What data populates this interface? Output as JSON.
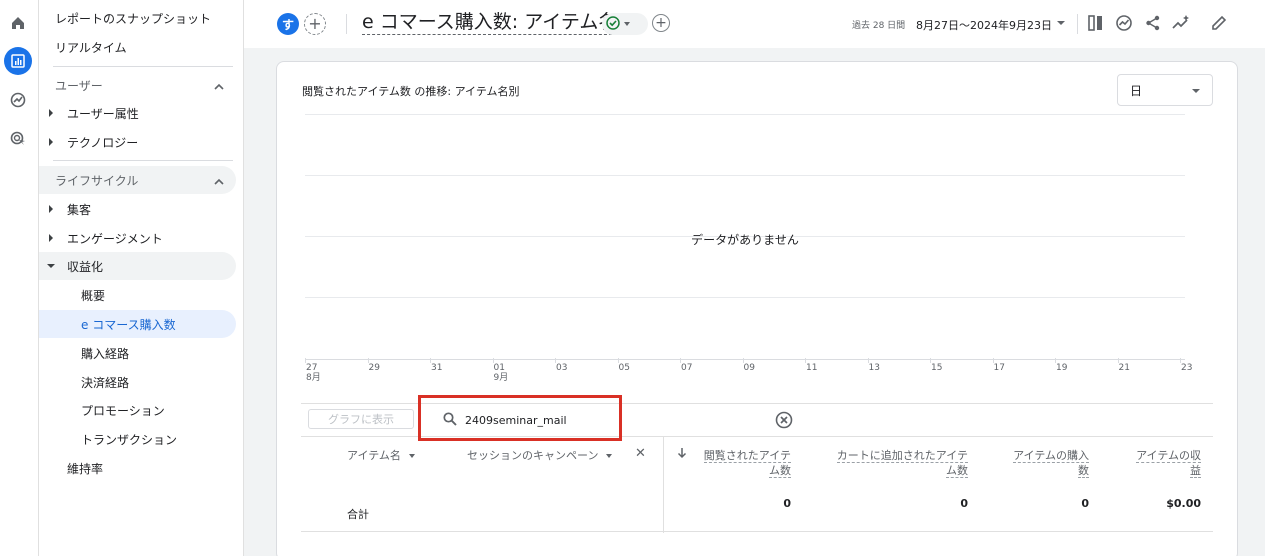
{
  "rail": {
    "icons": [
      "home-icon",
      "reports-icon",
      "explore-icon",
      "advertising-icon"
    ]
  },
  "sidebar": {
    "snapshot": "レポートのスナップショット",
    "realtime": "リアルタイム",
    "user_section": "ユーザー",
    "user_attributes": "ユーザー属性",
    "technology": "テクノロジー",
    "lifecycle_section": "ライフサイクル",
    "acquisition": "集客",
    "engagement": "エンゲージメント",
    "monetization": "収益化",
    "monetization_items": [
      "概要",
      "e コマース購入数",
      "購入経路",
      "決済経路",
      "プロモーション",
      "トランザクション"
    ],
    "retention": "維持率"
  },
  "header": {
    "avatar_letter": "す",
    "title": "e コマース購入数: アイテム名",
    "date_past": "過去 28 日間",
    "date_range": "8月27日～2024年9月23日"
  },
  "card": {
    "chart_title": "閲覧されたアイテム数 の推移: アイテム名別",
    "period": "日",
    "no_data": "データがありません"
  },
  "chart_data": {
    "type": "line",
    "x_tick_labels": [
      "27\n8月",
      "29",
      "31",
      "01\n9月",
      "03",
      "05",
      "07",
      "09",
      "11",
      "13",
      "15",
      "17",
      "19",
      "21",
      "23"
    ],
    "series": [],
    "annotation": "データがありません"
  },
  "table_toolbar": {
    "graph_button": "グラフに表示",
    "search_value": "2409seminar_mail"
  },
  "table": {
    "col_item_name": "アイテム名",
    "col_campaign": "セッションのキャンペーン",
    "col_viewed": [
      "閲覧されたアイテ",
      "ム数"
    ],
    "col_cart": [
      "カートに追加されたアイテ",
      "ム数"
    ],
    "col_purchased": [
      "アイテムの購入",
      "数"
    ],
    "col_revenue": [
      "アイテムの収",
      "益"
    ],
    "total_label": "合計",
    "total_viewed": "0",
    "total_cart": "0",
    "total_purchased": "0",
    "total_revenue": "$0.00"
  }
}
